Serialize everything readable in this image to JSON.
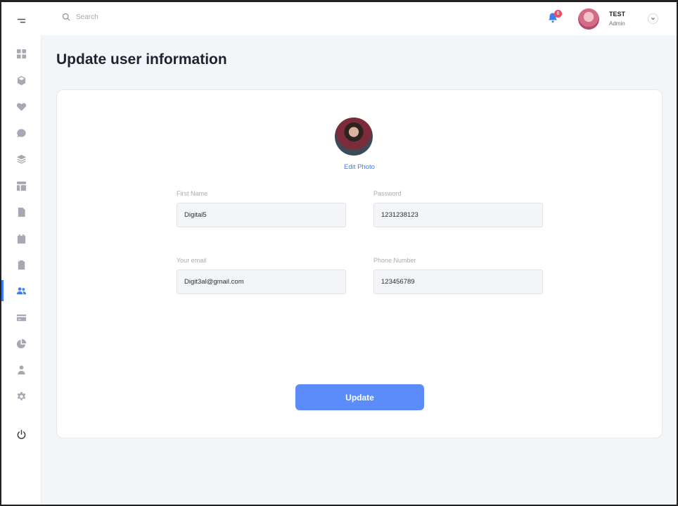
{
  "topbar": {
    "search_placeholder": "Search",
    "notifications_count": "6",
    "user": {
      "name": "TEST",
      "role": "Admin"
    }
  },
  "sidebar": {
    "items": [
      {
        "icon": "menu-toggle-icon"
      },
      {
        "icon": "dashboard-grid-icon"
      },
      {
        "icon": "cube-icon"
      },
      {
        "icon": "heart-icon"
      },
      {
        "icon": "chat-icon"
      },
      {
        "icon": "layers-icon"
      },
      {
        "icon": "layout-icon"
      },
      {
        "icon": "document-icon"
      },
      {
        "icon": "calendar-icon"
      },
      {
        "icon": "clipboard-icon"
      },
      {
        "icon": "users-icon",
        "active": true
      },
      {
        "icon": "credit-card-icon"
      },
      {
        "icon": "pie-chart-icon"
      },
      {
        "icon": "user-icon"
      },
      {
        "icon": "settings-gear-icon"
      },
      {
        "icon": "power-icon"
      }
    ]
  },
  "page": {
    "title": "Update user information"
  },
  "form": {
    "edit_photo_label": "Edit Photo",
    "first_name": {
      "label": "First Name",
      "value": "Digital5"
    },
    "password": {
      "label": "Password",
      "value": "1231238123"
    },
    "email": {
      "label": "Your email",
      "value": "Digit3al@gmail.com"
    },
    "phone": {
      "label": "Phone Number",
      "value": "123456789"
    },
    "submit_label": "Update"
  },
  "colors": {
    "accent": "#3d7ef5",
    "button": "#5c8cf9",
    "badge": "#f2495e",
    "background": "#f4f5f9"
  }
}
